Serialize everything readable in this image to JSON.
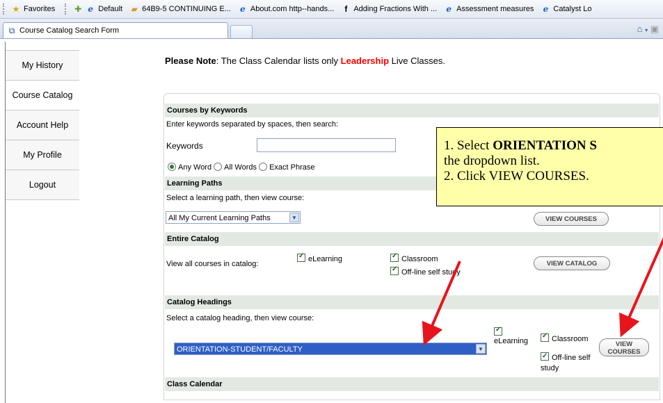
{
  "favorites": {
    "label": "Favorites",
    "links": [
      "Default",
      "64B9-5  CONTINUING E...",
      "About.com http--hands...",
      "Adding Fractions With ...",
      "Assessment measures",
      "Catalyst Lo"
    ]
  },
  "tab": {
    "title": "Course Catalog Search Form"
  },
  "sidebar": {
    "items": [
      "My History",
      "Course Catalog",
      "Account Help",
      "My Profile",
      "Logout"
    ]
  },
  "note": {
    "prefix": "Please Note",
    "text1": ": The Class Calendar lists only ",
    "highlight": "Leadership",
    "text2": " Live Classes."
  },
  "keywords": {
    "header": "Courses by Keywords",
    "instruction": "Enter keywords separated by spaces, then search:",
    "label": "Keywords",
    "value": "",
    "options": [
      "Any Word",
      "All Words",
      "Exact Phrase"
    ]
  },
  "paths": {
    "header": "Learning Paths",
    "instruction": "Select a learning path, then view course:",
    "selected": "All My Current Learning Paths",
    "button": "VIEW COURSES"
  },
  "catalog": {
    "header": "Entire Catalog",
    "instruction": "View all courses in catalog:",
    "elearning": "eLearning",
    "classroom": "Classroom",
    "offline": "Off-line self study",
    "button": "VIEW CATALOG"
  },
  "headings": {
    "header": "Catalog Headings",
    "instruction": "Select a catalog heading, then view course:",
    "selected": "ORIENTATION-STUDENT/FACULTY",
    "elearning": "eLearning",
    "classroom": "Classroom",
    "offline1": "Off-line self",
    "offline2": "study",
    "button1": "VIEW",
    "button2": "COURSES"
  },
  "calendar": {
    "header": "Class Calendar"
  },
  "callout": {
    "line1_pre": "1. Select ",
    "line1_bold": "ORIENTATION S",
    "line2": "the dropdown list.",
    "line3": "2. Click VIEW COURSES."
  },
  "colors": {
    "highlight": "#ff0000",
    "callout_bg": "#ffffaa",
    "arrow": "#e8141b"
  }
}
